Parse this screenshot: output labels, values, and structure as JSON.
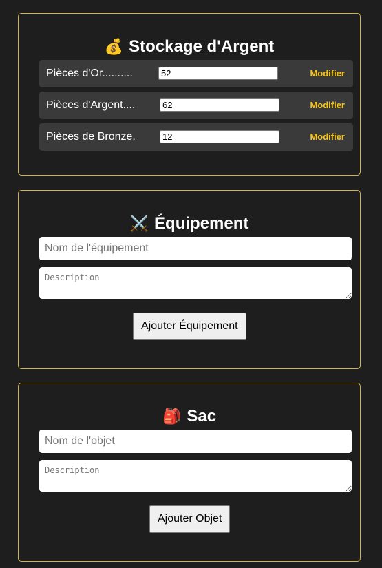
{
  "money": {
    "title": "Stockage d'Argent",
    "icon": "money-bag-icon",
    "rows": [
      {
        "label": "Pièces d'Or..........",
        "value": "52",
        "action": "Modifier"
      },
      {
        "label": "Pièces d'Argent....",
        "value": "62",
        "action": "Modifier"
      },
      {
        "label": "Pièces de Bronze.",
        "value": "12",
        "action": "Modifier"
      }
    ]
  },
  "equipment": {
    "title": "Équipement",
    "icon": "crossed-swords-icon",
    "name_placeholder": "Nom de l'équipement",
    "desc_placeholder": "Description",
    "button": "Ajouter Équipement"
  },
  "bag": {
    "title": "Sac",
    "icon": "backpack-icon",
    "name_placeholder": "Nom de l'objet",
    "desc_placeholder": "Description",
    "button": "Ajouter Objet"
  },
  "colors": {
    "background": "#1e1e1e",
    "panel_border": "#d4b44a",
    "row_background": "#3a3a3a",
    "accent": "#f5c518"
  }
}
